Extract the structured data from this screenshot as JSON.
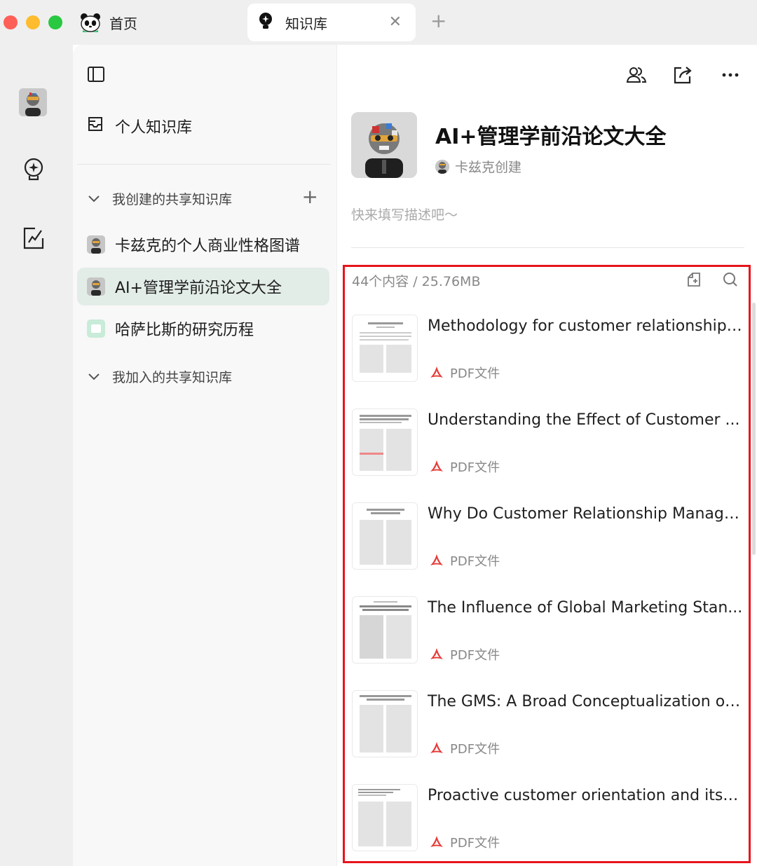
{
  "titlebar": {
    "home_tab": {
      "label": "首页",
      "icon": "panda-icon"
    },
    "kb_tab": {
      "label": "知识库",
      "icon": "bulb-icon",
      "close": "✕"
    },
    "new_tab": "+"
  },
  "rail": {
    "items": [
      "avatar",
      "bulb-icon",
      "edit-icon"
    ]
  },
  "sidebar": {
    "personal_label": "个人知识库",
    "created_group": "我创建的共享知识库",
    "joined_group": "我加入的共享知识库",
    "add": "+",
    "items": [
      {
        "label": "卡兹克的个人商业性格图谱",
        "active": false
      },
      {
        "label": "AI+管理学前沿论文大全",
        "active": true
      },
      {
        "label": "哈萨比斯的研究历程",
        "active": false
      }
    ]
  },
  "main": {
    "title": "AI+管理学前沿论文大全",
    "creator": "卡兹克创建",
    "description_placeholder": "快来填写描述吧～",
    "count": "44个内容 / 25.76MB",
    "docs": [
      {
        "name": "Methodology for customer relationship ...",
        "type": "PDF文件"
      },
      {
        "name": "Understanding the Effect of Customer ...",
        "type": "PDF文件"
      },
      {
        "name": "Why Do Customer Relationship Manage...",
        "type": "PDF文件"
      },
      {
        "name": "The Influence of Global Marketing Stan...",
        "type": "PDF文件"
      },
      {
        "name": "The GMS: A Broad Conceptualization of...",
        "type": "PDF文件"
      },
      {
        "name": "Proactive customer orientation and its r...",
        "type": "PDF文件"
      }
    ]
  },
  "colors": {
    "accent_red": "#e8141c",
    "active_bg": "#e3ede8",
    "pdf_red": "#e53935"
  }
}
